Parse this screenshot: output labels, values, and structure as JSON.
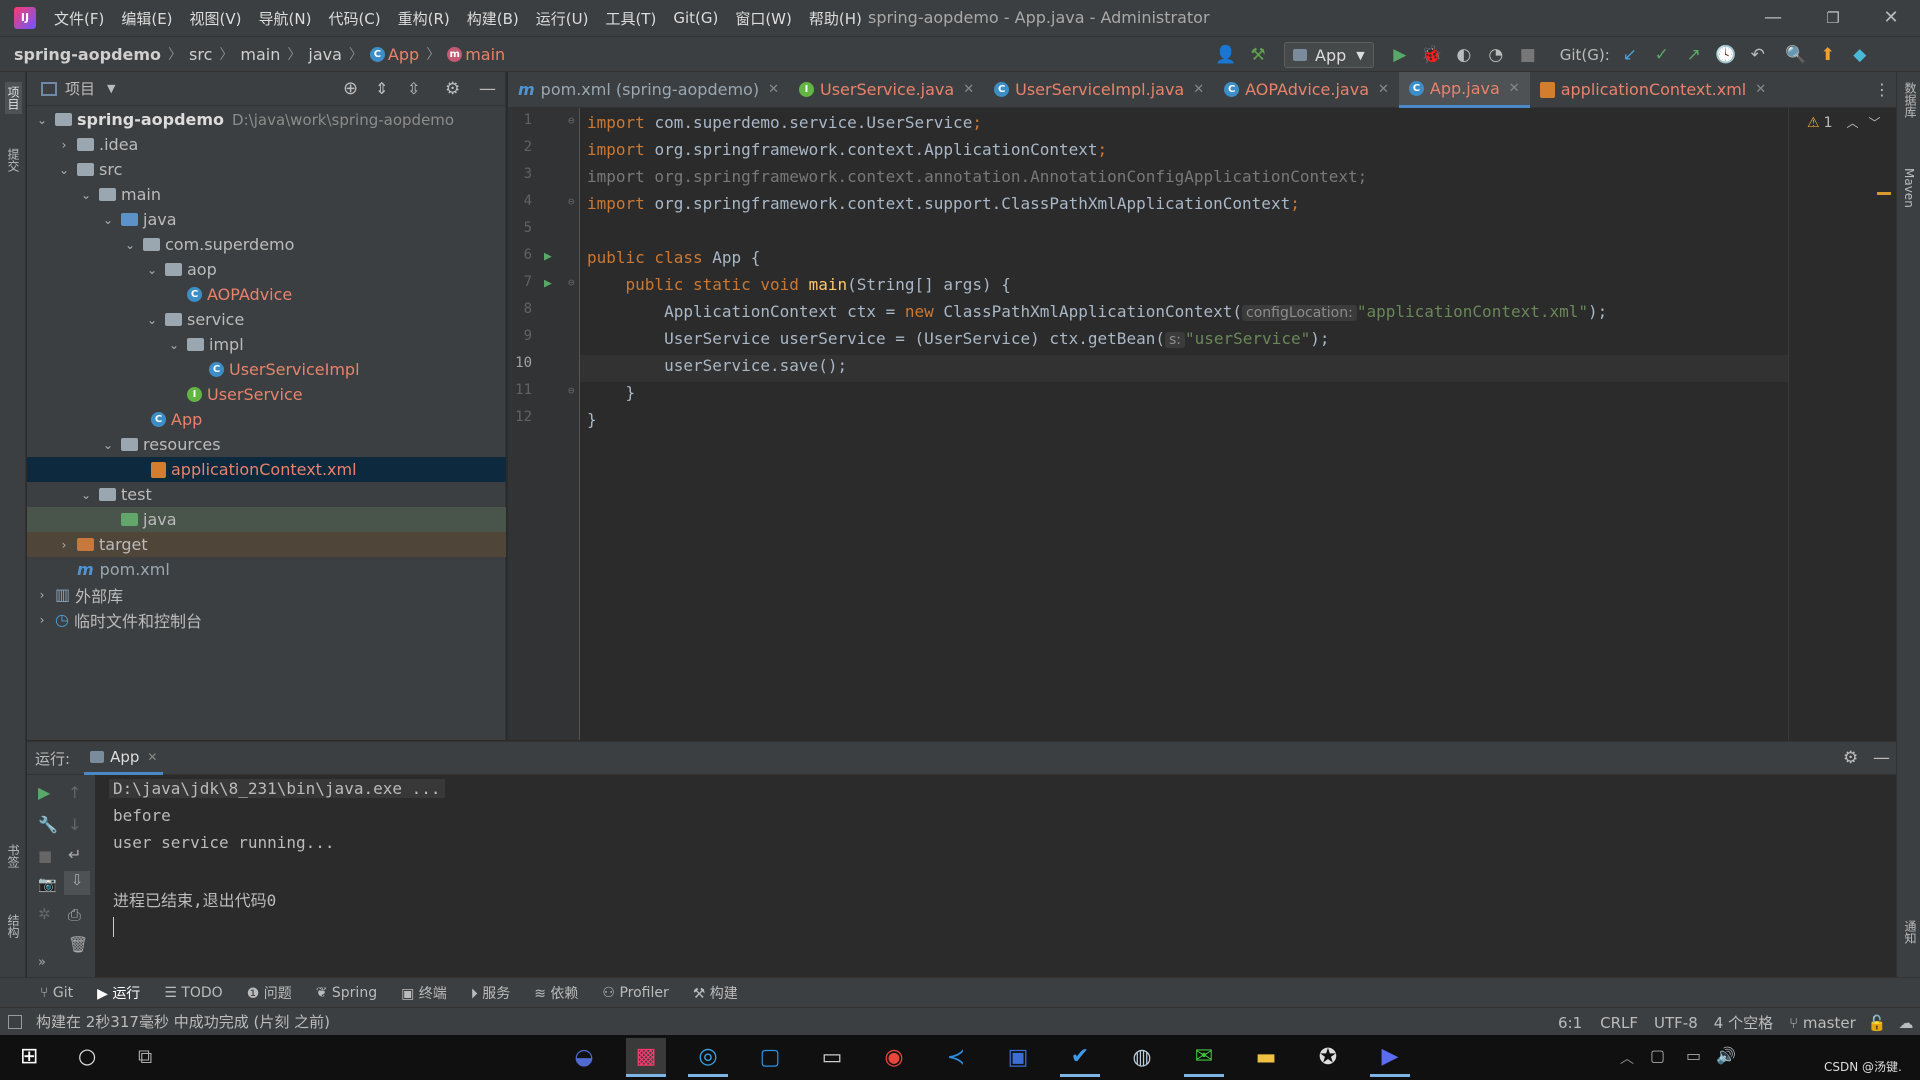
{
  "window": {
    "menu": [
      "文件(F)",
      "编辑(E)",
      "视图(V)",
      "导航(N)",
      "代码(C)",
      "重构(R)",
      "构建(B)",
      "运行(U)",
      "工具(T)",
      "Git(G)",
      "窗口(W)",
      "帮助(H)"
    ],
    "title": "spring-aopdemo - App.java - Administrator",
    "minimize": "—",
    "restore": "❐",
    "close": "✕"
  },
  "navbar": {
    "crumbs": [
      "spring-aopdemo",
      "src",
      "main",
      "java",
      "App",
      "main"
    ],
    "run_config": "App",
    "git_label": "Git(G):"
  },
  "left_strip": {
    "project": "项目",
    "commit": "提交",
    "bookmarks": "书签",
    "structure": "结构"
  },
  "right_strip": {
    "database": "数据库",
    "maven": "Maven",
    "notifications": "通知"
  },
  "project": {
    "header": "项目",
    "tree": [
      {
        "name": "spring-aopdemo",
        "path": "D:\\java\\work\\spring-aopdemo"
      },
      {
        "name": ".idea"
      },
      {
        "name": "src"
      },
      {
        "name": "main"
      },
      {
        "name": "java"
      },
      {
        "name": "com.superdemo"
      },
      {
        "name": "aop"
      },
      {
        "name": "AOPAdvice"
      },
      {
        "name": "service"
      },
      {
        "name": "impl"
      },
      {
        "name": "UserServiceImpl"
      },
      {
        "name": "UserService"
      },
      {
        "name": "App"
      },
      {
        "name": "resources"
      },
      {
        "name": "applicationContext.xml"
      },
      {
        "name": "test"
      },
      {
        "name": "java"
      },
      {
        "name": "target"
      },
      {
        "name": "pom.xml"
      },
      {
        "name": "外部库"
      },
      {
        "name": "临时文件和控制台"
      }
    ]
  },
  "tabs": [
    {
      "label": "pom.xml (spring-aopdemo)",
      "icon": "m"
    },
    {
      "label": "UserService.java",
      "icon": "I"
    },
    {
      "label": "UserServiceImpl.java",
      "icon": "C"
    },
    {
      "label": "AOPAdvice.java",
      "icon": "C"
    },
    {
      "label": "App.java",
      "icon": "C"
    },
    {
      "label": "applicationContext.xml",
      "icon": "xml"
    }
  ],
  "editor": {
    "warnings": "1",
    "line_numbers": [
      "1",
      "2",
      "3",
      "4",
      "5",
      "6",
      "7",
      "8",
      "9",
      "10",
      "11",
      "12"
    ],
    "lines": {
      "l1a": "import ",
      "l1b": "com.superdemo.service.UserService",
      "l1c": ";",
      "l2a": "import ",
      "l2b": "org.springframework.context.ApplicationContext",
      "l2c": ";",
      "l3": "import org.springframework.context.annotation.AnnotationConfigApplicationContext;",
      "l4a": "import ",
      "l4b": "org.springframework.context.support.ClassPathXmlApplicationContext",
      "l4c": ";",
      "l6a": "public class ",
      "l6b": "App {",
      "l7a": "    public static void ",
      "l7b": "main",
      "l7c": "(String[] args) {",
      "l8a": "        ApplicationContext ctx = ",
      "l8b": "new ",
      "l8c": "ClassPathXmlApplicationContext(",
      "l8hint": "configLocation:",
      "l8d": "\"applicationContext.xml\"",
      "l8e": ");",
      "l9a": "        UserService userService = (UserService) ctx.getBean(",
      "l9hint": "s:",
      "l9b": "\"userService\"",
      "l9c": ");",
      "l10": "        userService.save();",
      "l11": "    }",
      "l12": "}"
    }
  },
  "run": {
    "label": "运行:",
    "tab": "App",
    "console": [
      "D:\\java\\jdk\\8_231\\bin\\java.exe ...",
      "before",
      "user service running...",
      "",
      "进程已结束,退出代码0"
    ]
  },
  "tool_windows": [
    "Git",
    "运行",
    "TODO",
    "问题",
    "Spring",
    "终端",
    "服务",
    "依赖",
    "Profiler",
    "构建"
  ],
  "status": {
    "message": "构建在 2秒317毫秒 中成功完成 (片刻 之前)",
    "position": "6:1",
    "line_sep": "CRLF",
    "encoding": "UTF-8",
    "indent": "4 个空格",
    "branch": "master"
  },
  "taskbar": {
    "watermark": "CSDN @汤键."
  }
}
